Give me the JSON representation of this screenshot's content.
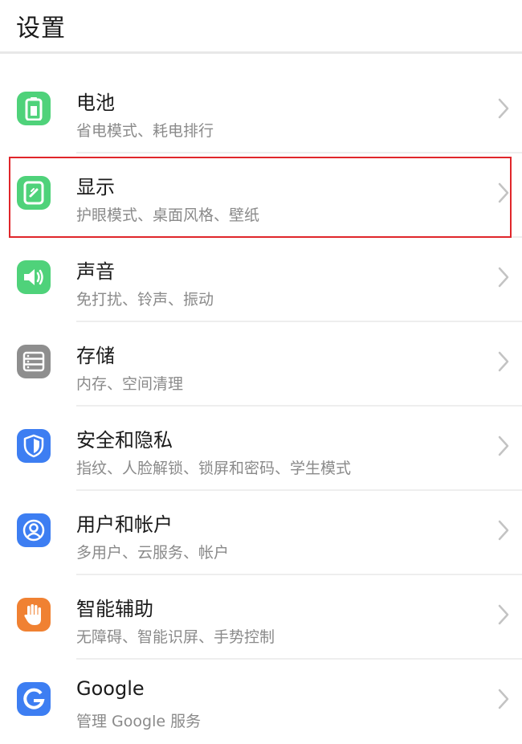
{
  "header": {
    "title": "设置"
  },
  "colors": {
    "green": "#4fd27a",
    "grey": "#8e8e8e",
    "blue": "#3d7ef2",
    "orange": "#f08132",
    "highlight": "#e0262b"
  },
  "items": [
    {
      "label": "电池",
      "sub": "省电模式、耗电排行",
      "icon": "battery-icon"
    },
    {
      "label": "显示",
      "sub": "护眼模式、桌面风格、壁纸",
      "icon": "display-icon"
    },
    {
      "label": "声音",
      "sub": "免打扰、铃声、振动",
      "icon": "speaker-icon"
    },
    {
      "label": "存储",
      "sub": "内存、空间清理",
      "icon": "storage-icon"
    },
    {
      "label": "安全和隐私",
      "sub": "指纹、人脸解锁、锁屏和密码、学生模式",
      "icon": "shield-icon"
    },
    {
      "label": "用户和帐户",
      "sub": "多用户、云服务、帐户",
      "icon": "user-icon"
    },
    {
      "label": "智能辅助",
      "sub": "无障碍、智能识屏、手势控制",
      "icon": "hand-icon"
    },
    {
      "label": "Google",
      "sub": "管理 Google 服务",
      "icon": "google-icon"
    }
  ]
}
